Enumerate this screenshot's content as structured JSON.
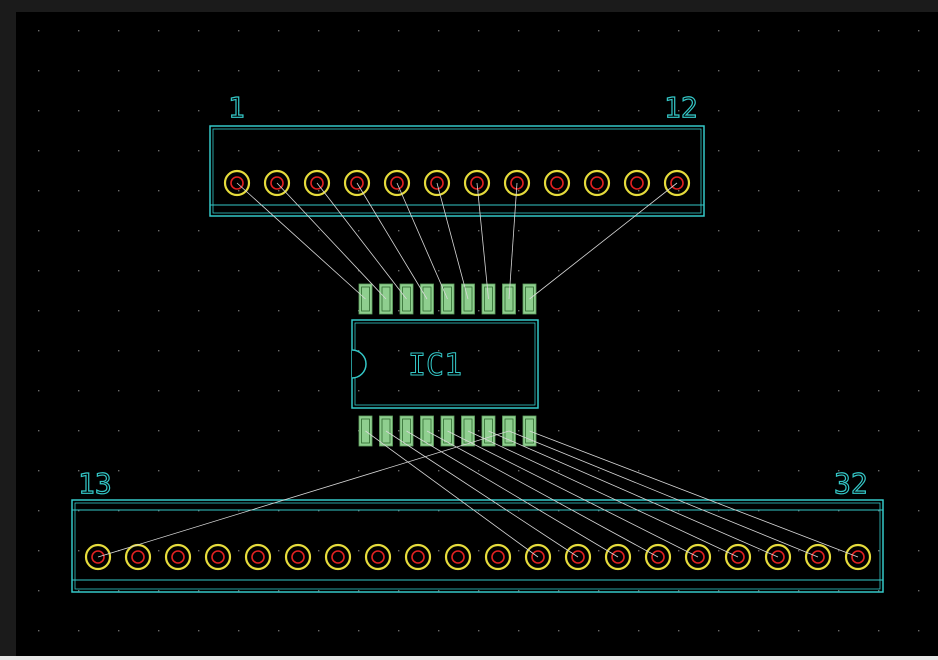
{
  "colors": {
    "background": "#000000",
    "outline": "#34c8c8",
    "pad_ring": "#e6dc3c",
    "pad_hole": "#e02020",
    "smd_pad": "#8fcf8f",
    "ratsnest": "#d8d8d8",
    "grid_dot": "#6a6a6a",
    "label": "#34c8c8"
  },
  "top_header": {
    "first_pin_label": "1",
    "last_pin_label": "12",
    "pin_count": 12
  },
  "bottom_header": {
    "first_pin_label": "13",
    "last_pin_label": "32",
    "pin_count": 20
  },
  "ic": {
    "reference": "IC1",
    "pins_per_side": 9,
    "pad_style": "smd"
  },
  "icons": [
    "connector-pad-icon",
    "smd-pad-icon",
    "ic-notch-icon"
  ]
}
